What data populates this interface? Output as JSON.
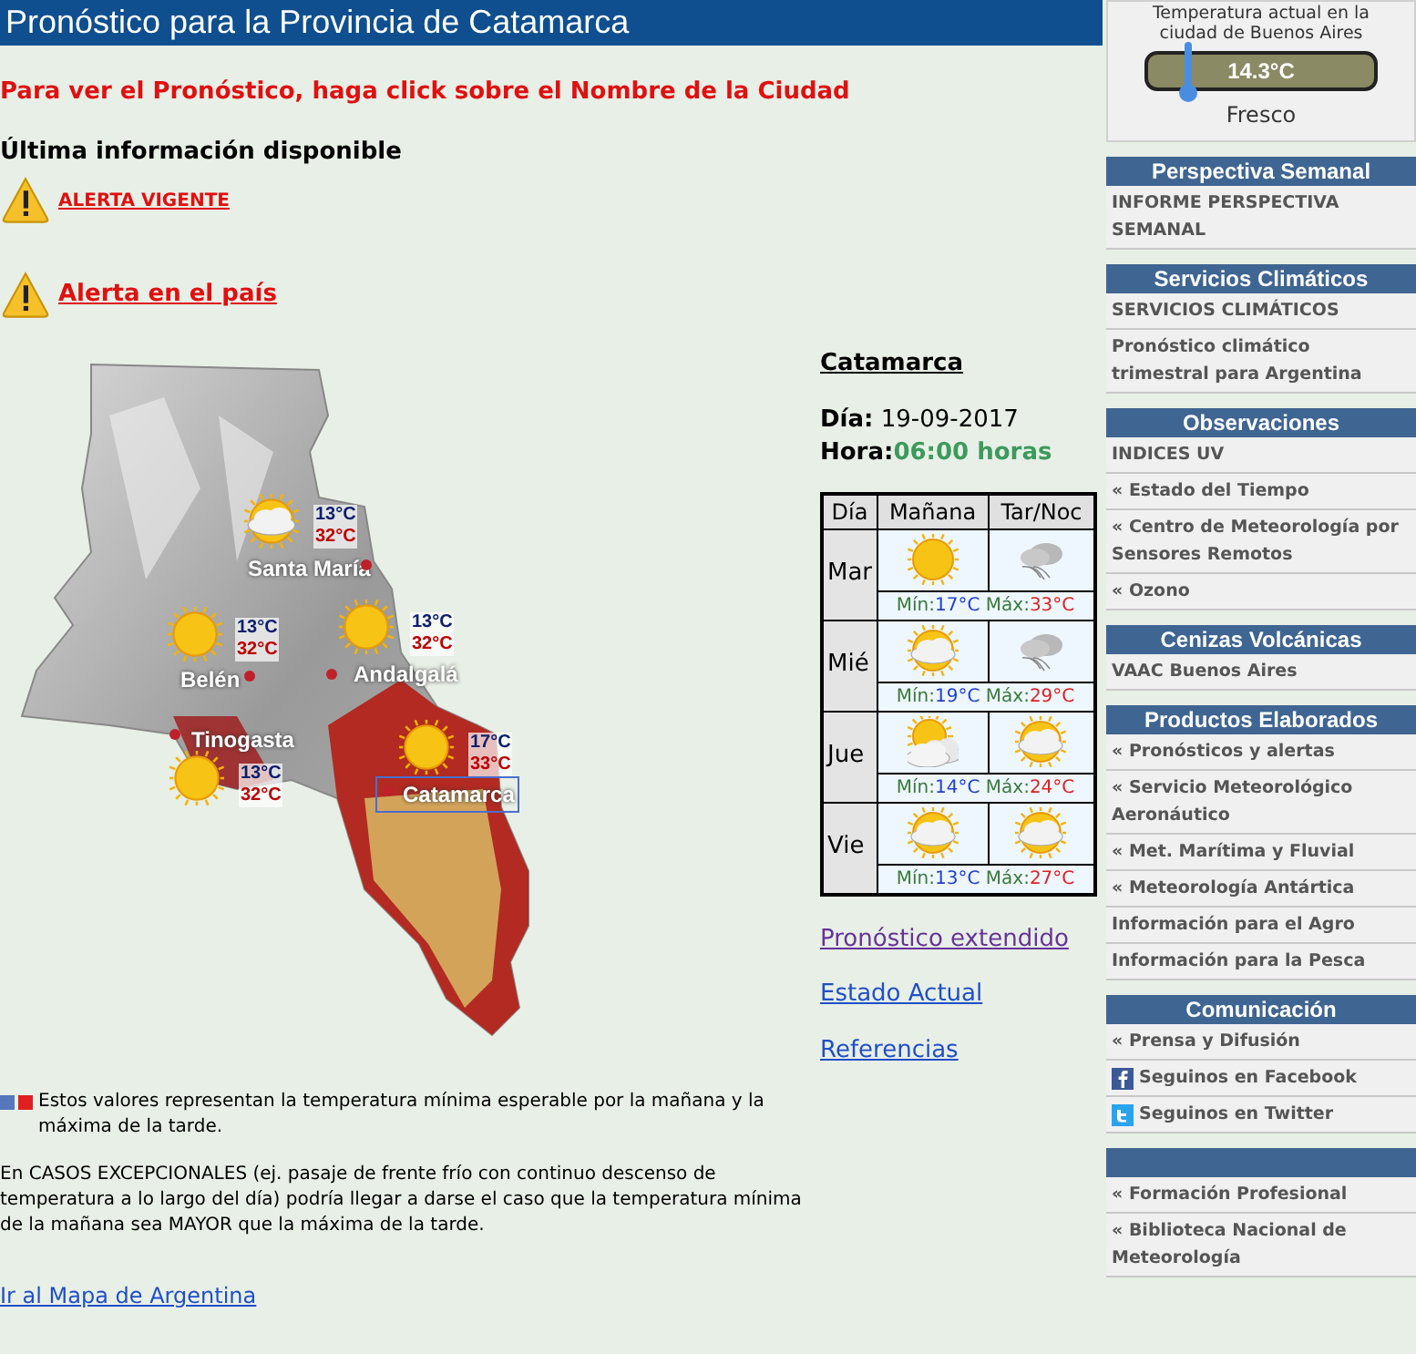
{
  "header": {
    "title": "Pronóstico para la Provincia de Catamarca"
  },
  "instruction": "Para ver el Pronóstico, haga click sobre el Nombre de la Ciudad",
  "latest_heading": "Última información disponible",
  "alerts": [
    {
      "label": "ALERTA VIGENTE",
      "kind": "small"
    },
    {
      "label": "Alerta en el país",
      "kind": "large"
    }
  ],
  "map": {
    "cities": [
      {
        "name": "Santa María",
        "min": "13°C",
        "max": "32°C",
        "icon": {
          "kind": "partly_cloudy"
        },
        "selected": false
      },
      {
        "name": "Belén",
        "min": "13°C",
        "max": "32°C",
        "icon": {
          "kind": "sunny"
        },
        "selected": false
      },
      {
        "name": "Andalgalá",
        "min": "13°C",
        "max": "32°C",
        "icon": {
          "kind": "sunny"
        },
        "selected": false
      },
      {
        "name": "Tinogasta",
        "min": "13°C",
        "max": "32°C",
        "icon": {
          "kind": "sunny"
        },
        "selected": false
      },
      {
        "name": "Catamarca",
        "min": "17°C",
        "max": "33°C",
        "icon": {
          "kind": "sunny"
        },
        "selected": true
      }
    ]
  },
  "forecast": {
    "city": "Catamarca",
    "date_label": "Día:",
    "date": "19-09-2017",
    "time_label": "Hora:",
    "time": "06:00 horas",
    "columns": [
      "Día",
      "Mañana",
      "Tar/Noc"
    ],
    "rows": [
      {
        "day": "Mar",
        "morning": {
          "kind": "sunny"
        },
        "afternoon": {
          "kind": "cloudy_wind"
        },
        "min_label": "Mín:",
        "min": "17°C",
        "max_label": "Máx:",
        "max": "33°C"
      },
      {
        "day": "Mié",
        "morning": {
          "kind": "partly_cloudy"
        },
        "afternoon": {
          "kind": "cloudy_wind"
        },
        "min_label": "Mín:",
        "min": "19°C",
        "max_label": "Máx:",
        "max": "29°C"
      },
      {
        "day": "Jue",
        "morning": {
          "kind": "mostly_cloudy"
        },
        "afternoon": {
          "kind": "partly_cloudy"
        },
        "min_label": "Mín:",
        "min": "14°C",
        "max_label": "Máx:",
        "max": "24°C"
      },
      {
        "day": "Vie",
        "morning": {
          "kind": "partly_cloudy"
        },
        "afternoon": {
          "kind": "partly_cloudy"
        },
        "min_label": "Mín:",
        "min": "13°C",
        "max_label": "Máx:",
        "max": "27°C"
      }
    ],
    "links": [
      {
        "label": "Pronóstico extendido",
        "visited": true
      },
      {
        "label": "Estado Actual",
        "visited": false
      },
      {
        "label": "Referencias",
        "visited": false
      }
    ]
  },
  "legend": "Estos valores representan la temperatura mínima esperable por la mañana y la máxima de la tarde.",
  "note": "En CASOS EXCEPCIONALES (ej. pasaje de frente frío con continuo descenso de temperatura a lo largo del día) podría llegar a darse el caso que la temperatura mínima de la mañana sea MAYOR que la máxima de la tarde.",
  "map_link": "Ir al Mapa de Argentina",
  "sidebar": {
    "weather_widget": {
      "caption": "Temperatura actual en la ciudad de Buenos Aires",
      "temperature": "14.3°C",
      "condition": "Fresco"
    },
    "sections": [
      {
        "title": "Perspectiva Semanal",
        "items": [
          {
            "label": "INFORME PERSPECTIVA SEMANAL",
            "kind": "plain"
          }
        ]
      },
      {
        "title": "Servicios Climáticos",
        "items": [
          {
            "label": "SERVICIOS CLIMÁTICOS",
            "kind": "plain"
          },
          {
            "label": "Pronóstico climático trimestral para Argentina",
            "kind": "plain"
          }
        ]
      },
      {
        "title": "Observaciones",
        "items": [
          {
            "label": "INDICES UV",
            "kind": "plain"
          },
          {
            "label": "« Estado del Tiempo",
            "kind": "plain"
          },
          {
            "label": "« Centro de Meteorología por Sensores Remotos",
            "kind": "plain"
          },
          {
            "label": "« Ozono",
            "kind": "plain"
          }
        ]
      },
      {
        "title": "Cenizas Volcánicas",
        "items": [
          {
            "label": "VAAC Buenos Aires",
            "kind": "plain"
          }
        ]
      },
      {
        "title": "Productos Elaborados",
        "items": [
          {
            "label": "« Pronósticos y alertas",
            "kind": "plain"
          },
          {
            "label": "« Servicio Meteorológico Aeronáutico",
            "kind": "plain"
          },
          {
            "label": "« Met. Marítima y Fluvial",
            "kind": "plain"
          },
          {
            "label": "« Meteorología Antártica",
            "kind": "plain"
          },
          {
            "label": "Información para el Agro",
            "kind": "plain"
          },
          {
            "label": "Información para la Pesca",
            "kind": "plain"
          }
        ]
      },
      {
        "title": "Comunicación",
        "items": [
          {
            "label": "« Prensa y Difusión",
            "kind": "plain"
          },
          {
            "label": "Seguinos en Facebook",
            "kind": "facebook"
          },
          {
            "label": "Seguinos en Twitter",
            "kind": "twitter"
          }
        ]
      },
      {
        "items": [
          {
            "label": "« Formación Profesional",
            "kind": "plain"
          },
          {
            "label": "« Biblioteca Nacional de Meteorología",
            "kind": "plain"
          }
        ]
      }
    ]
  }
}
